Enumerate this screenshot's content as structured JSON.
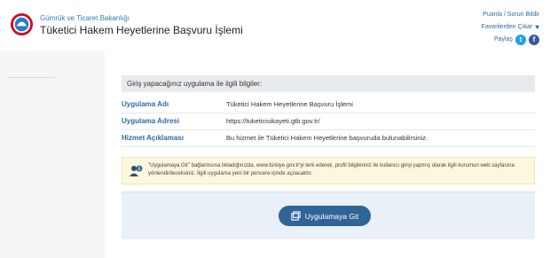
{
  "header": {
    "ministry": "Gümrük ve Ticaret Bakanlığı",
    "service_title": "Tüketici Hakem Heyetlerine Başvuru İşlemi",
    "links": {
      "rate": "Puanla / Sorun Bildir",
      "favorites": "Favorilerden Çıkar",
      "share": "Paylaş"
    }
  },
  "info": {
    "heading": "Giriş yapacağınız uygulama ile ilgili bilgiler:",
    "rows": [
      {
        "key": "Uygulama Adı",
        "value": "Tüketici Hakem Heyetlerine Başvuru İşlemi"
      },
      {
        "key": "Uygulama Adresi",
        "value": "https://tuketicisikayeti.gtb.gov.tr/"
      },
      {
        "key": "Hizmet Açıklaması",
        "value": "Bu hizmet ile Tüketici Hakem Heyetlerine başvuruda bulunabilirsiniz."
      }
    ]
  },
  "notice": {
    "text": "\"Uygulamaya Git\" bağlantısına tıkladığınızda, www.türkiye.gov.tr'yi terk ederek, profil bilgileriniz ile kullanıcı girişi yapmış olarak ilgili kurumun web sayfasına yönlendirileceksiniz. İlgili uygulama yeni bir pencere içinde açılacaktır."
  },
  "action": {
    "button_label": "Uygulamaya Git"
  },
  "colors": {
    "accent": "#2d6aa8",
    "button": "#2f6497",
    "notice_bg": "#fdf7dd",
    "action_bg": "#e9f0f7"
  },
  "icons": [
    "ministry-logo",
    "twitter-icon",
    "facebook-icon",
    "heart-icon",
    "info-user-icon",
    "external-window-icon"
  ]
}
